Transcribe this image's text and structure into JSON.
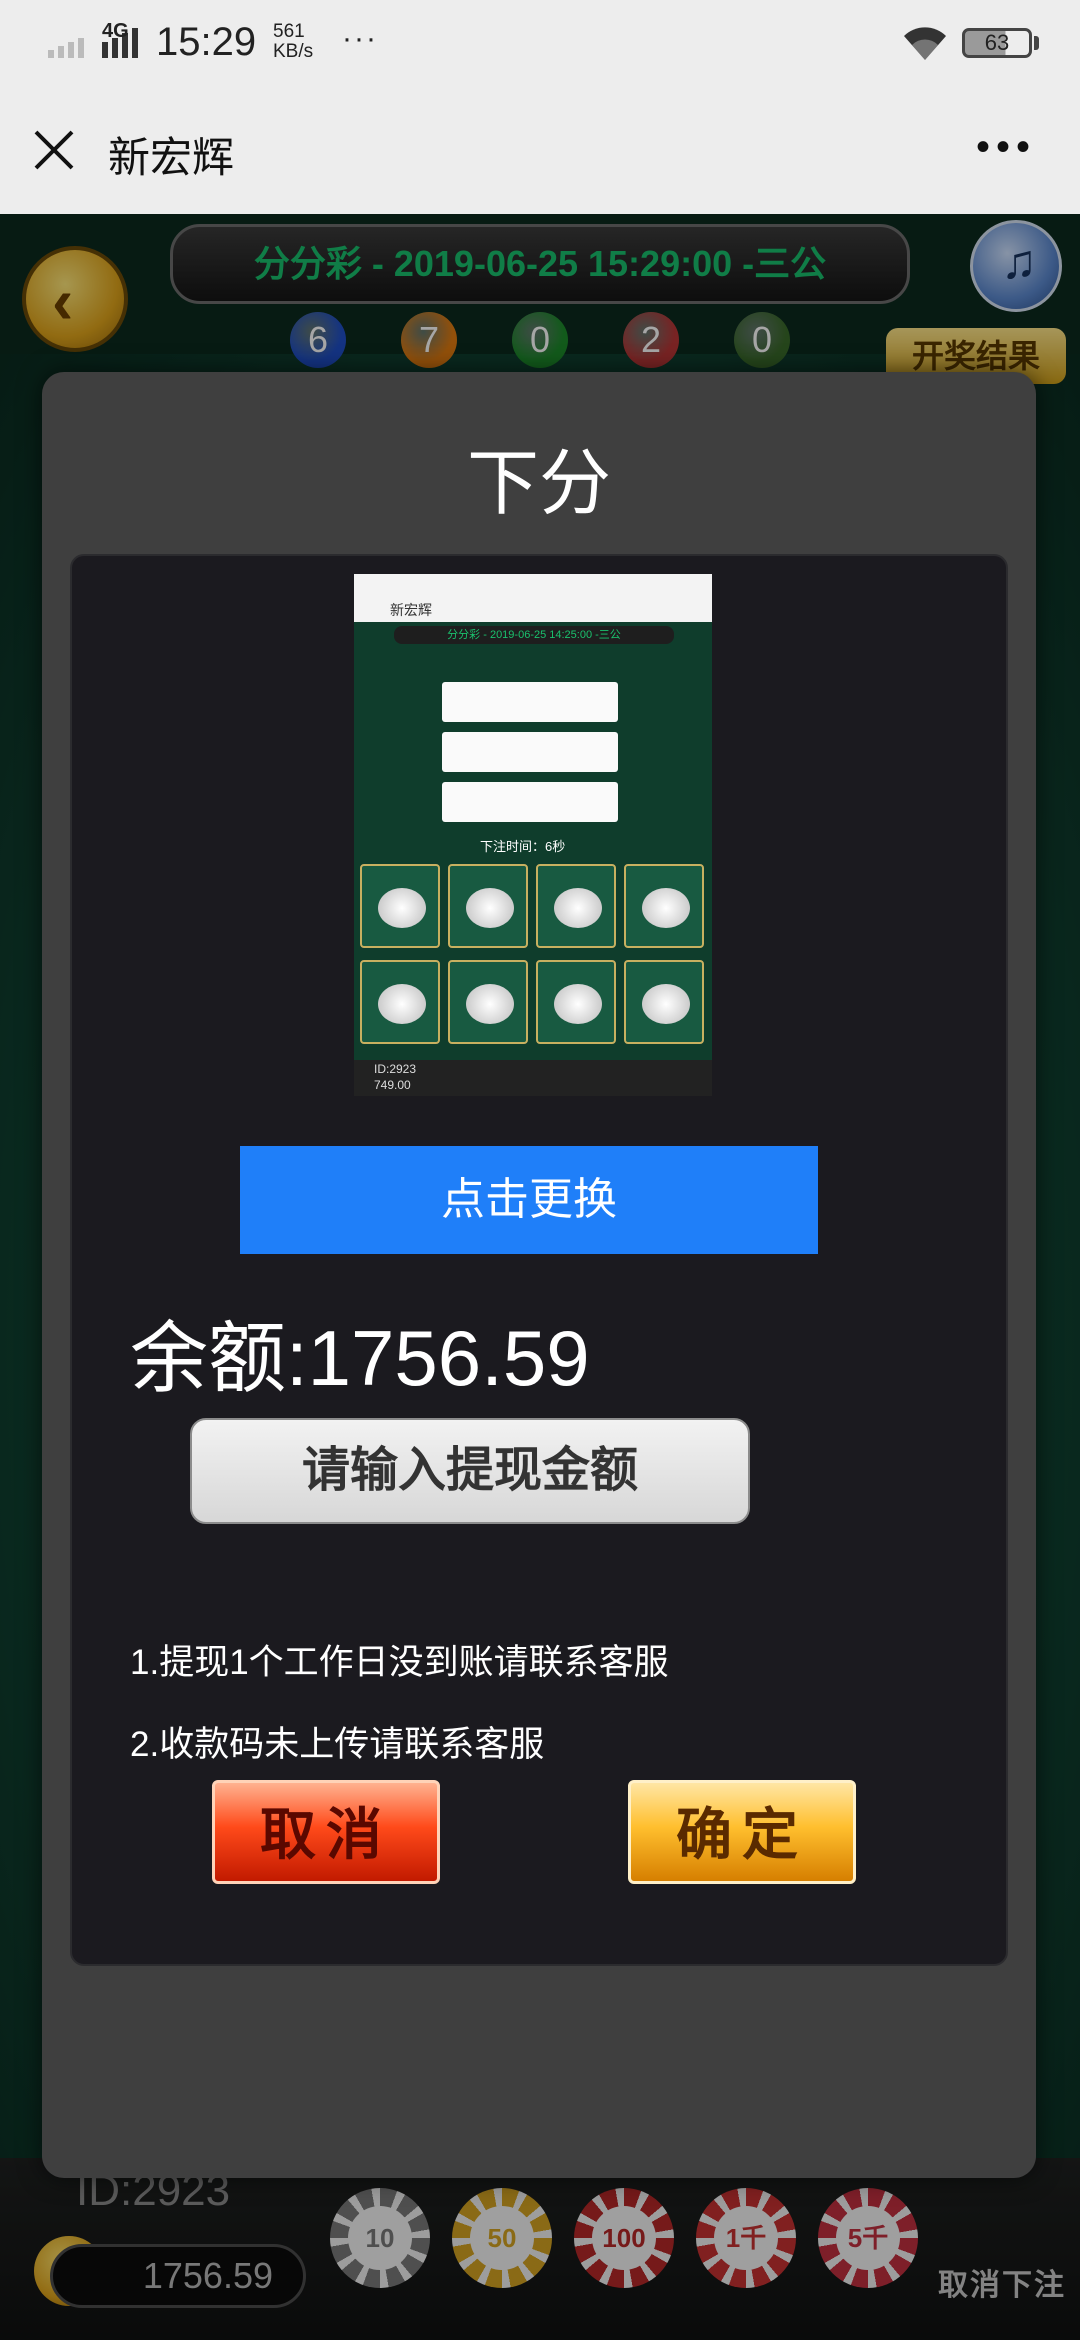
{
  "status_bar": {
    "network": "4G",
    "time": "15:29",
    "speed_value": "561",
    "speed_unit": "KB/s",
    "more": "···",
    "battery": "63"
  },
  "title_bar": {
    "title": "新宏辉",
    "close_icon": "close-icon",
    "more_icon": "more-icon"
  },
  "game": {
    "title": "分分彩 - 2019-06-25 15:29:00 -三公",
    "balls": [
      "6",
      "7",
      "0",
      "2",
      "0"
    ],
    "ball_colors": [
      "#1f4fc8",
      "#e07b10",
      "#1c8a2a",
      "#b83636",
      "#3a6a2a"
    ],
    "open_result": "开奖结果",
    "player_id": "ID:2923",
    "player_balance": "1756.59",
    "chips": [
      "10",
      "50",
      "100",
      "1千",
      "5千"
    ],
    "chip_colors": [
      "#7a7a7a",
      "#d4a422",
      "#b52828",
      "#c63232",
      "#c23040"
    ],
    "cancel_bet": "取消下注"
  },
  "dialog": {
    "title": "下分",
    "qr_thumb": {
      "app_title": "新宏辉",
      "game_title": "分分彩 - 2019-06-25 14:25:00 -三公",
      "bet_time": "下注时间：6秒",
      "id": "ID:2923",
      "balance": "749.00"
    },
    "change_button": "点击更换",
    "balance_label": "余额:1756.59",
    "amount_placeholder": "请输入提现金额",
    "notes": [
      "1.提现1个工作日没到账请联系客服",
      "2.收款码未上传请联系客服"
    ],
    "cancel_button": "取消",
    "confirm_button": "确定"
  }
}
